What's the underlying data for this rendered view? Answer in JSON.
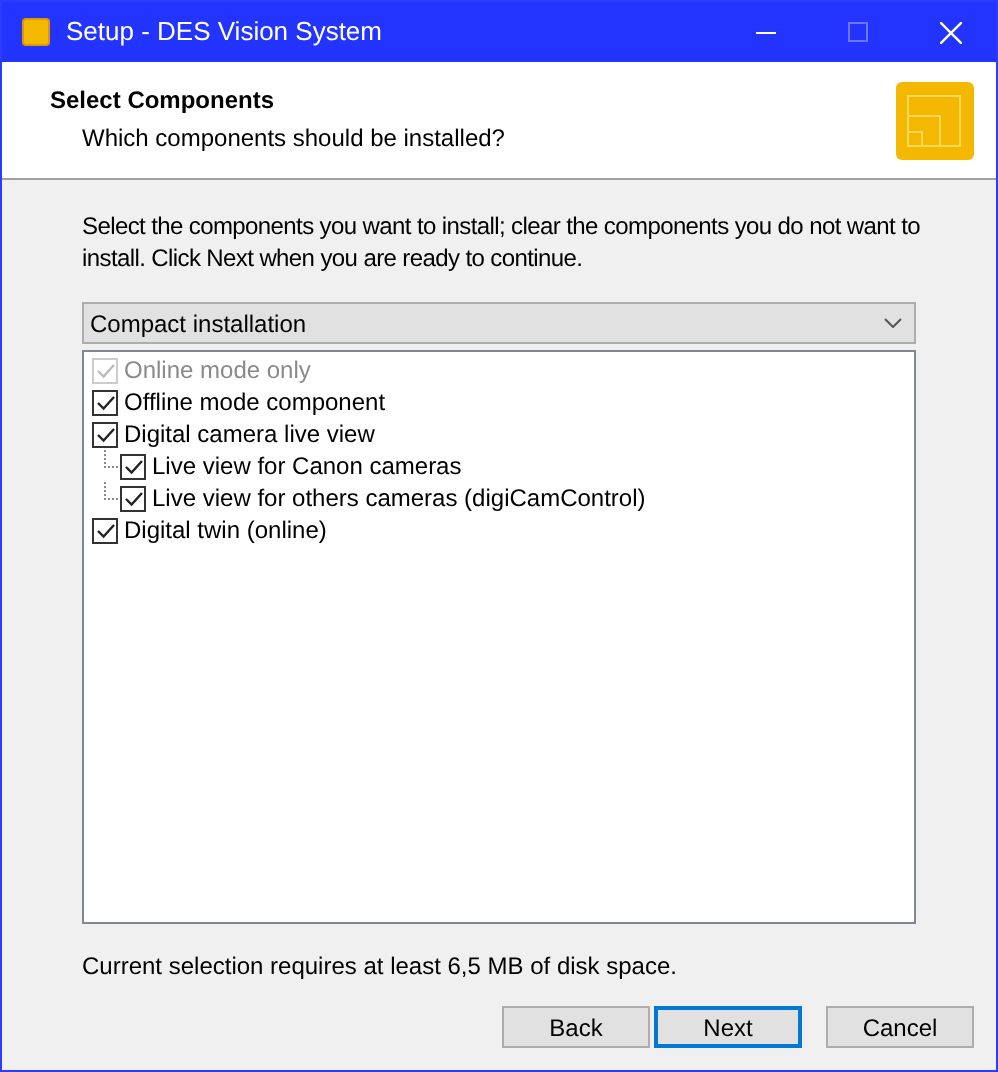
{
  "window": {
    "title": "Setup - DES Vision System"
  },
  "header": {
    "title": "Select Components",
    "subtitle": "Which components should be installed?"
  },
  "instructions": "Select the components you want to install; clear the components you do not want to install. Click Next when you are ready to continue.",
  "setup_type": {
    "value": "Compact installation"
  },
  "components": [
    {
      "label": "Online mode only",
      "checked": true,
      "disabled": true
    },
    {
      "label": "Offline mode component",
      "checked": true,
      "disabled": false
    },
    {
      "label": "Digital camera live view",
      "checked": true,
      "disabled": false,
      "children": [
        {
          "label": "Live view for Canon cameras",
          "checked": true,
          "disabled": false
        },
        {
          "label": "Live view for others cameras (digiCamControl)",
          "checked": true,
          "disabled": false
        }
      ]
    },
    {
      "label": "Digital twin (online)",
      "checked": true,
      "disabled": false
    }
  ],
  "disk_space": "Current selection requires at least 6,5 MB of disk space.",
  "buttons": [
    {
      "label": "Back",
      "focused": false
    },
    {
      "label": "Next",
      "focused": true
    },
    {
      "label": "Cancel",
      "focused": false
    }
  ]
}
